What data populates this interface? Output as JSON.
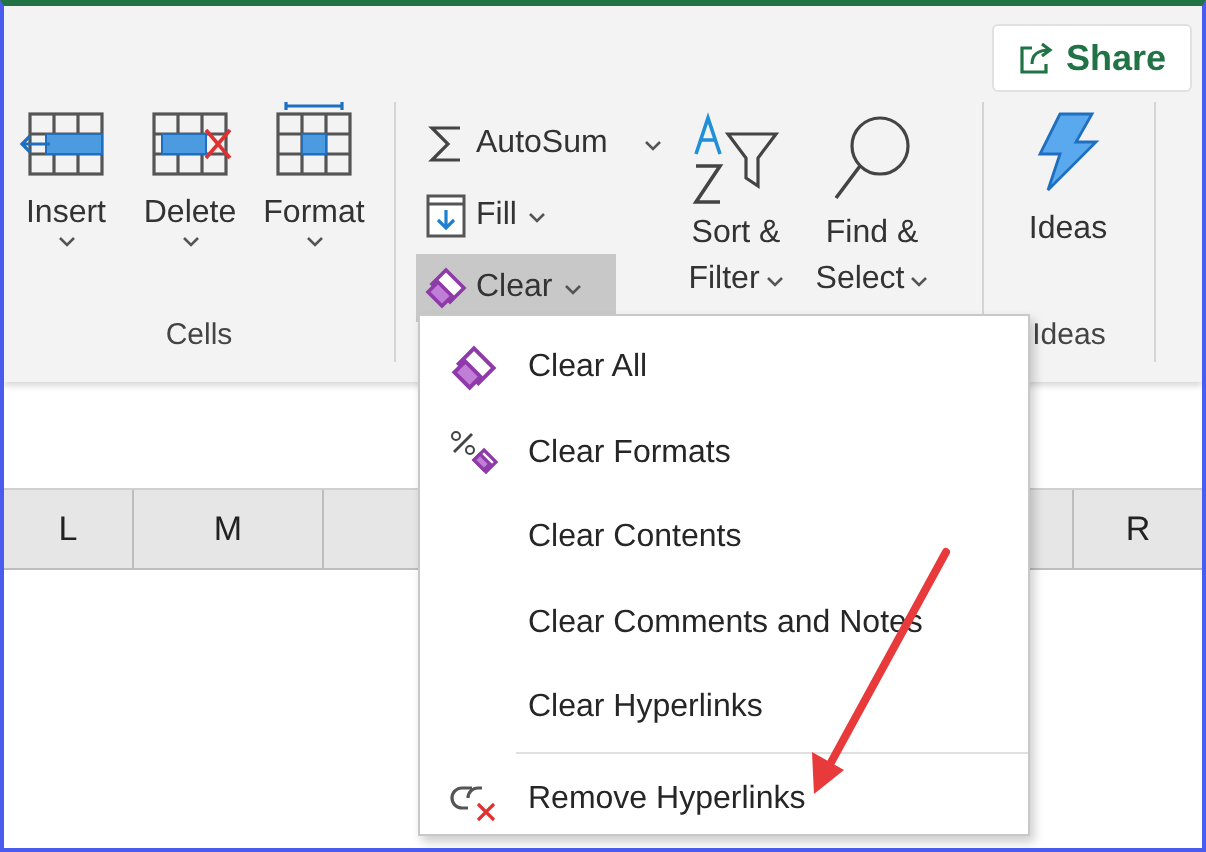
{
  "share": {
    "label": "Share"
  },
  "cells": {
    "label": "Cells",
    "buttons": [
      {
        "kind": "insert",
        "label": "Insert"
      },
      {
        "kind": "delete",
        "label": "Delete"
      },
      {
        "kind": "format",
        "label": "Format"
      }
    ]
  },
  "editing": {
    "small_buttons": [
      {
        "kind": "sum",
        "label": "AutoSum",
        "selected": false
      },
      {
        "kind": "fill",
        "label": "Fill",
        "selected": false
      },
      {
        "kind": "eraser",
        "label": "Clear",
        "selected": true
      }
    ],
    "big_buttons": [
      {
        "kind": "sort",
        "lines": [
          "Sort &",
          "Filter"
        ]
      },
      {
        "kind": "find",
        "lines": [
          "Find &",
          "Select"
        ]
      }
    ]
  },
  "ideas": {
    "button": "Ideas",
    "label": "Ideas"
  },
  "columns": [
    {
      "label": "L"
    },
    {
      "label": "M"
    },
    {
      "label": "R"
    }
  ],
  "menu": [
    {
      "kind": "eraser",
      "label": "Clear All",
      "divider_above": false
    },
    {
      "kind": "formats",
      "label": "Clear Formats",
      "divider_above": false
    },
    {
      "kind": "plain",
      "label": "Clear Contents",
      "divider_above": false
    },
    {
      "kind": "plain",
      "label": "Clear Comments and Notes",
      "divider_above": false
    },
    {
      "kind": "plain",
      "label": "Clear Hyperlinks",
      "divider_above": false
    },
    {
      "kind": "unlink",
      "label": "Remove Hyperlinks",
      "divider_above": true
    }
  ]
}
